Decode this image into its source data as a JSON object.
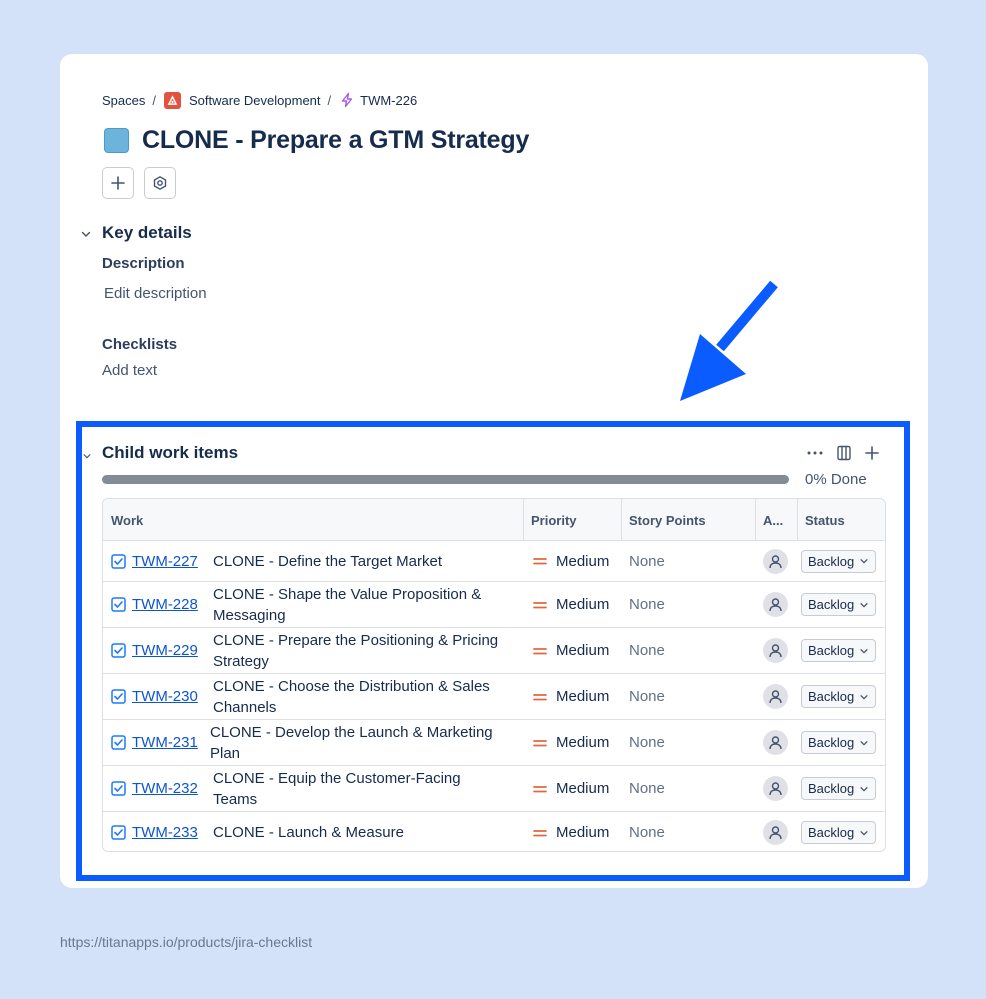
{
  "breadcrumb": {
    "spaces": "Spaces",
    "separator": "/",
    "project": "Software Development",
    "parent_key": "TWM-226"
  },
  "issue": {
    "title": "CLONE - Prepare a GTM Strategy",
    "type_color": "#6cb4dc"
  },
  "toolbar": {
    "add_icon": "plus-icon",
    "apps_icon": "hexagon-settings-icon"
  },
  "key_details": {
    "heading": "Key details",
    "description_label": "Description",
    "description_placeholder": "Edit description",
    "checklists_label": "Checklists",
    "checklists_placeholder": "Add text"
  },
  "child_items": {
    "heading": "Child work items",
    "progress_done": 0,
    "progress_text": "0% Done",
    "columns": [
      "Work",
      "Priority",
      "Story Points",
      "A...",
      "Status"
    ],
    "rows": [
      {
        "key": "TWM-227",
        "summary": "CLONE - Define the Target Market",
        "priority": "Medium",
        "story_points": "None",
        "status": "Backlog"
      },
      {
        "key": "TWM-228",
        "summary": "CLONE - Shape the Value Proposition & Messaging",
        "priority": "Medium",
        "story_points": "None",
        "status": "Backlog"
      },
      {
        "key": "TWM-229",
        "summary": "CLONE - Prepare the Positioning & Pricing Strategy",
        "priority": "Medium",
        "story_points": "None",
        "status": "Backlog"
      },
      {
        "key": "TWM-230",
        "summary": "CLONE - Choose the Distribution & Sales Channels",
        "priority": "Medium",
        "story_points": "None",
        "status": "Backlog"
      },
      {
        "key": "TWM-231",
        "summary": "CLONE - Develop the Launch & Marketing Plan",
        "priority": "Medium",
        "story_points": "None",
        "status": "Backlog"
      },
      {
        "key": "TWM-232",
        "summary": "CLONE - Equip the Customer-Facing Teams",
        "priority": "Medium",
        "story_points": "None",
        "status": "Backlog"
      },
      {
        "key": "TWM-233",
        "summary": "CLONE - Launch & Measure",
        "priority": "Medium",
        "story_points": "None",
        "status": "Backlog"
      }
    ]
  },
  "colors": {
    "background": "#d3e2f8",
    "highlight": "#0b5cff",
    "link": "#0c55cf",
    "priority_medium": "#e2683c"
  },
  "footer": {
    "url": "https://titanapps.io/products/jira-checklist"
  }
}
